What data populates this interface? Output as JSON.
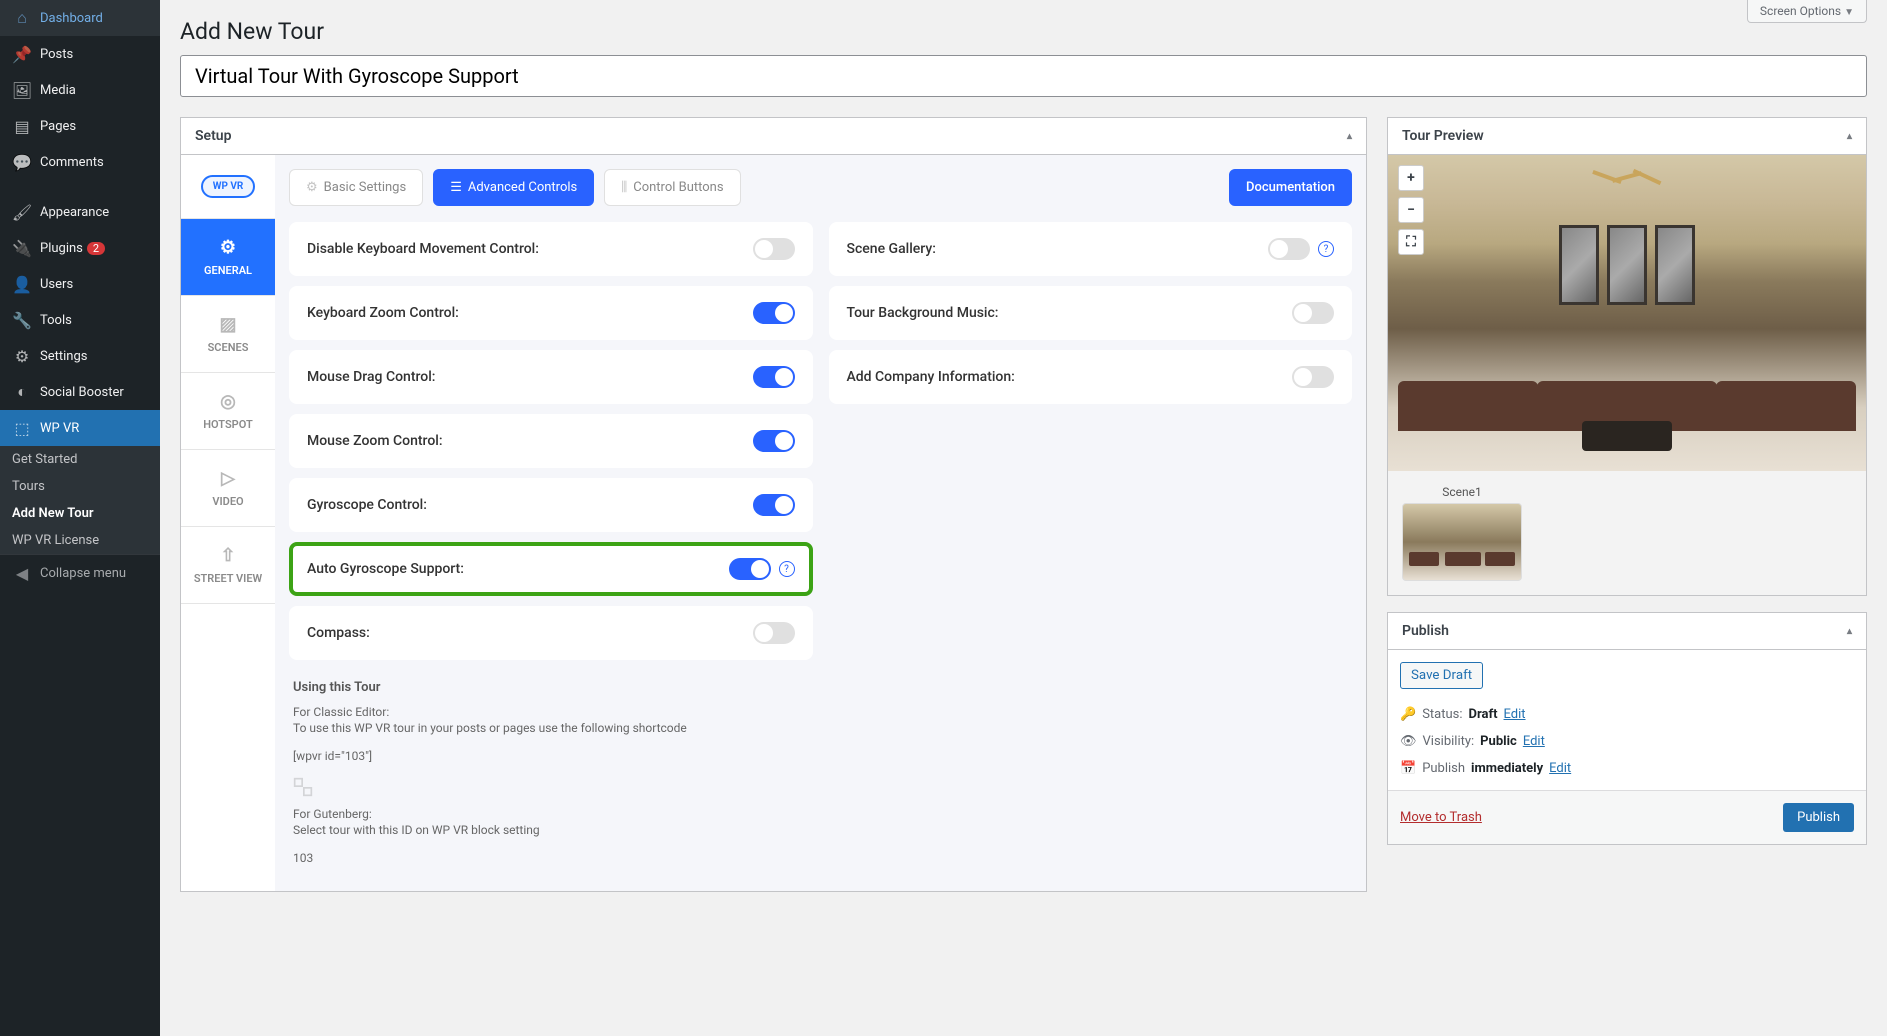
{
  "screen_options": "Screen Options",
  "page_title": "Add New Tour",
  "title_value": "Virtual Tour With Gyroscope Support",
  "sidebar": {
    "items": [
      {
        "icon": "⌂",
        "label": "Dashboard"
      },
      {
        "icon": "📌",
        "label": "Posts"
      },
      {
        "icon": "🖼",
        "label": "Media"
      },
      {
        "icon": "▤",
        "label": "Pages"
      },
      {
        "icon": "💬",
        "label": "Comments"
      },
      {
        "icon": "🖌",
        "label": "Appearance"
      },
      {
        "icon": "🔌",
        "label": "Plugins",
        "badge": "2"
      },
      {
        "icon": "👤",
        "label": "Users"
      },
      {
        "icon": "🔧",
        "label": "Tools"
      },
      {
        "icon": "⚙",
        "label": "Settings"
      },
      {
        "icon": "◐",
        "label": "Social Booster"
      },
      {
        "icon": "⬚",
        "label": "WP VR",
        "active": true
      }
    ],
    "sub": [
      {
        "label": "Get Started"
      },
      {
        "label": "Tours"
      },
      {
        "label": "Add New Tour",
        "active": true
      },
      {
        "label": "WP VR License"
      }
    ],
    "collapse": "Collapse menu"
  },
  "setup": {
    "title": "Setup",
    "logo": "WP VR",
    "tabs": [
      {
        "icon": "⚙",
        "label": "GENERAL",
        "active": true
      },
      {
        "icon": "▨",
        "label": "SCENES"
      },
      {
        "icon": "◎",
        "label": "HOTSPOT"
      },
      {
        "icon": "▷",
        "label": "VIDEO"
      },
      {
        "icon": "⇧",
        "label": "STREET VIEW"
      }
    ],
    "toolbar": {
      "basic": "Basic Settings",
      "advanced": "Advanced Controls",
      "control": "Control Buttons",
      "doc": "Documentation"
    },
    "settings_left": [
      {
        "label": "Disable Keyboard Movement Control:",
        "on": false,
        "highlighted": false
      },
      {
        "label": "Keyboard Zoom Control:",
        "on": true,
        "highlighted": false
      },
      {
        "label": "Mouse Drag Control:",
        "on": true,
        "highlighted": false
      },
      {
        "label": "Mouse Zoom Control:",
        "on": true,
        "highlighted": false
      },
      {
        "label": "Gyroscope Control:",
        "on": true,
        "highlighted": false
      },
      {
        "label": "Auto Gyroscope Support:",
        "on": true,
        "highlighted": true,
        "help": true
      },
      {
        "label": "Compass:",
        "on": false,
        "highlighted": false
      }
    ],
    "settings_right": [
      {
        "label": "Scene Gallery:",
        "on": false,
        "help": true
      },
      {
        "label": "Tour Background Music:",
        "on": false
      },
      {
        "label": "Add Company Information:",
        "on": false
      }
    ],
    "using": {
      "title": "Using this Tour",
      "classic_h": "For Classic Editor:",
      "classic_p": "To use this WP VR tour in your posts or pages use the following shortcode",
      "shortcode": "[wpvr id=\"103\"]",
      "gutenberg_h": "For Gutenberg:",
      "gutenberg_p": "Select tour with this ID on WP VR block setting",
      "id": "103"
    }
  },
  "preview": {
    "title": "Tour Preview",
    "scene_label": "Scene1",
    "controls": {
      "zoom_in": "+",
      "zoom_out": "−",
      "fullscreen": "⛶"
    }
  },
  "publish": {
    "title": "Publish",
    "save_draft": "Save Draft",
    "status_label": "Status:",
    "status_value": "Draft",
    "visibility_label": "Visibility:",
    "visibility_value": "Public",
    "publish_label": "Publish",
    "publish_value": "immediately",
    "edit": "Edit",
    "trash": "Move to Trash",
    "button": "Publish"
  }
}
